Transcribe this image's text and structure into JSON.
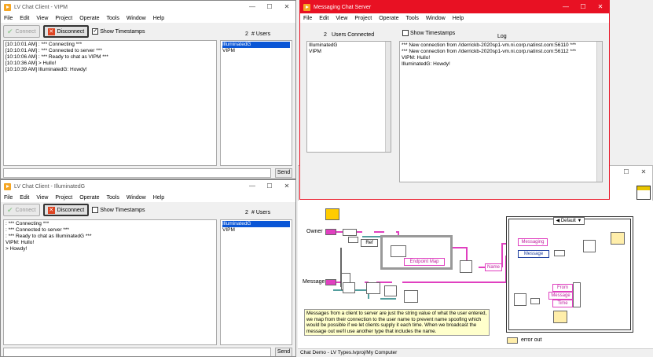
{
  "client_vipm": {
    "title": "LV Chat Client - VIPM",
    "menu": [
      "File",
      "Edit",
      "View",
      "Project",
      "Operate",
      "Tools",
      "Window",
      "Help"
    ],
    "connect_label": "Connect",
    "disconnect_label": "Disconnect",
    "show_timestamps_label": "Show Timestamps",
    "show_timestamps_checked": true,
    "user_count": "2",
    "users_label": "# Users",
    "log": [
      "[10:10:01 AM] : *** Connecting ***",
      "[10:10:01 AM] : *** Connected to server ***",
      "[10:10:06 AM] : *** Ready to chat as VIPM ***",
      "[10:10:36 AM] > Hullo!",
      "[10:10:39 AM] IlluminatedG: Howdy!"
    ],
    "users": [
      "IlluminatedG",
      "VIPM"
    ],
    "send_label": "Send"
  },
  "client_ig": {
    "title": "LV Chat Client - IlluminatedG",
    "menu": [
      "File",
      "Edit",
      "View",
      "Project",
      "Operate",
      "Tools",
      "Window",
      "Help"
    ],
    "connect_label": "Connect",
    "disconnect_label": "Disconnect",
    "show_timestamps_label": "Show Timestamps",
    "show_timestamps_checked": false,
    "user_count": "2",
    "users_label": "# Users",
    "log": [
      ": *** Connecting ***",
      ": *** Connected to server ***",
      ": *** Ready to chat as IlluminatedG ***",
      "VIPM: Hullo!",
      "> Howdy!"
    ],
    "users": [
      "IlluminatedG",
      "VIPM"
    ],
    "send_label": "Send"
  },
  "server": {
    "title": "Messaging Chat Server",
    "menu": [
      "File",
      "Edit",
      "View",
      "Project",
      "Operate",
      "Tools",
      "Window",
      "Help"
    ],
    "user_count": "2",
    "users_connected_label": "Users Connected",
    "show_timestamps_label": "Show Timestamps",
    "log_label": "Log",
    "users": [
      "IlluminatedG",
      "VIPM"
    ],
    "log": [
      "*** New connection from //derrickb-2020sp1-vm.ni.corp.natinst.com:56110 ***",
      "*** New connection from //derrickb-2020sp1-vm.ni.corp.natinst.com:56112 ***",
      "VIPM: Hullo!",
      "IlluminatedG: Howdy!"
    ],
    "accent": "#e81123"
  },
  "diagram": {
    "owner_label": "Owner",
    "message_label": "Message",
    "ref_label": "Ref",
    "endpoint_map_label": "Endpoint Map",
    "name_label": "Name",
    "case_label": "Default",
    "messaging_label": "Messaging",
    "message_enum_label": "Message",
    "from_label": "From",
    "message_field_label": "Message",
    "time_label": "Time",
    "error_out_label": "error out",
    "comment": "Messages from a client to server are just the string value of what the user entered, we map from their connection to the user name to prevent name spoofing which would be possible if we let clients supply it each time. When we broadcast the message out we'll use another type that includes the name.",
    "status_path": "Chat Demo - LV Types.lvproj/My Computer"
  }
}
